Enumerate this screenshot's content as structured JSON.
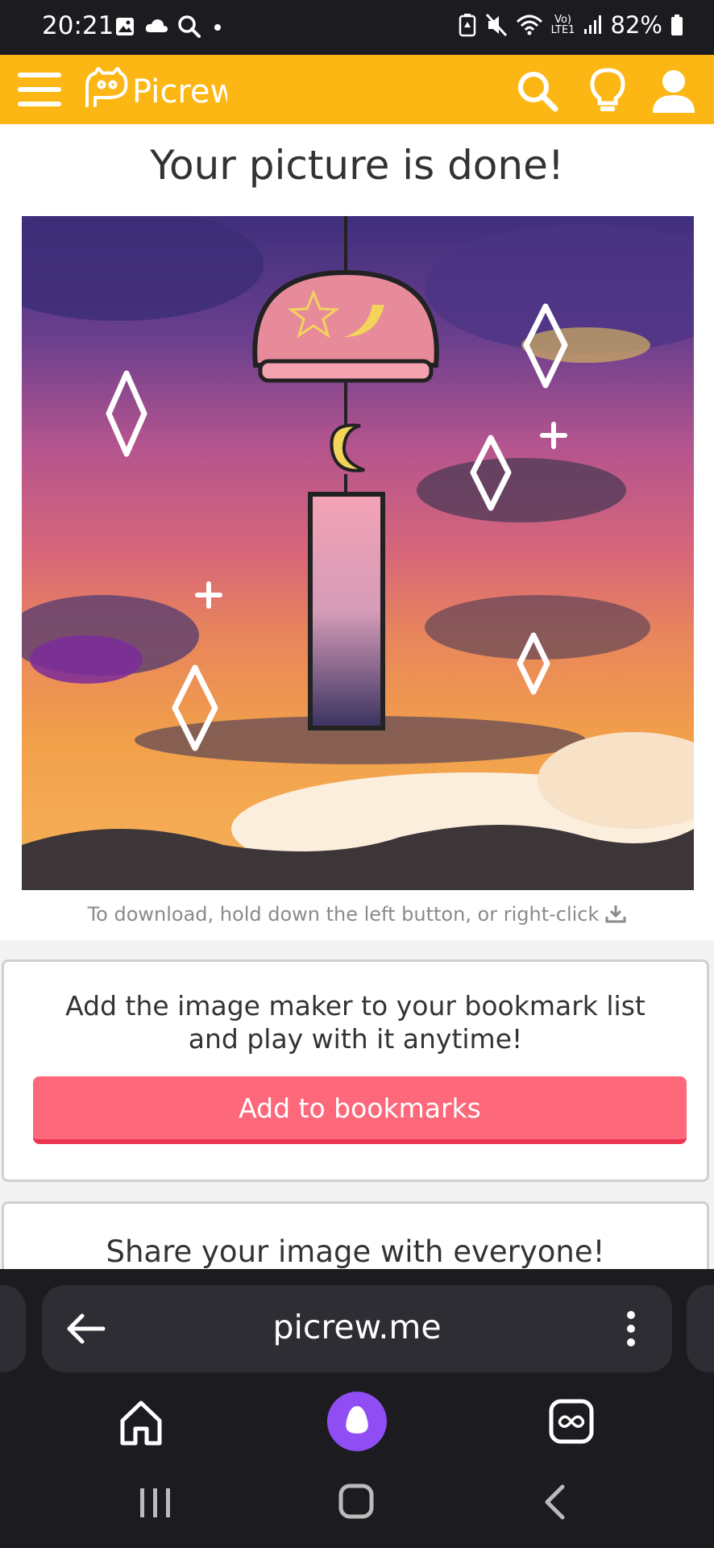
{
  "status_bar": {
    "time": "20:21",
    "network_label": "Vo) LTE1",
    "battery": "82%",
    "icons": [
      "gallery-icon",
      "cloud-icon",
      "search-icon",
      "dot-icon",
      "battery-saver-icon",
      "mute-icon",
      "wifi-icon",
      "signal-icon",
      "battery-icon"
    ]
  },
  "header": {
    "logo_text": "Picrew",
    "accent_color": "#fcb714",
    "icons": [
      "menu-icon",
      "search-icon",
      "lightbulb-icon",
      "user-icon"
    ]
  },
  "main": {
    "title": "Your picture is done!",
    "download_hint": "To download, hold down the left button, or right-click",
    "download_icon": "download-icon"
  },
  "bookmark": {
    "text_line1": "Add the image maker to your bookmark list",
    "text_line2": "and play with it anytime!",
    "button_label": "Add to bookmarks",
    "button_color": "#fd687b"
  },
  "share": {
    "title": "Share your image with everyone!"
  },
  "browser": {
    "url": "picrew.me",
    "icons": [
      "back-arrow-icon",
      "more-icon",
      "home-icon",
      "alice-assistant-icon",
      "tabs-icon"
    ]
  },
  "system_nav": {
    "icons": [
      "recents-icon",
      "home-icon",
      "back-icon"
    ]
  }
}
